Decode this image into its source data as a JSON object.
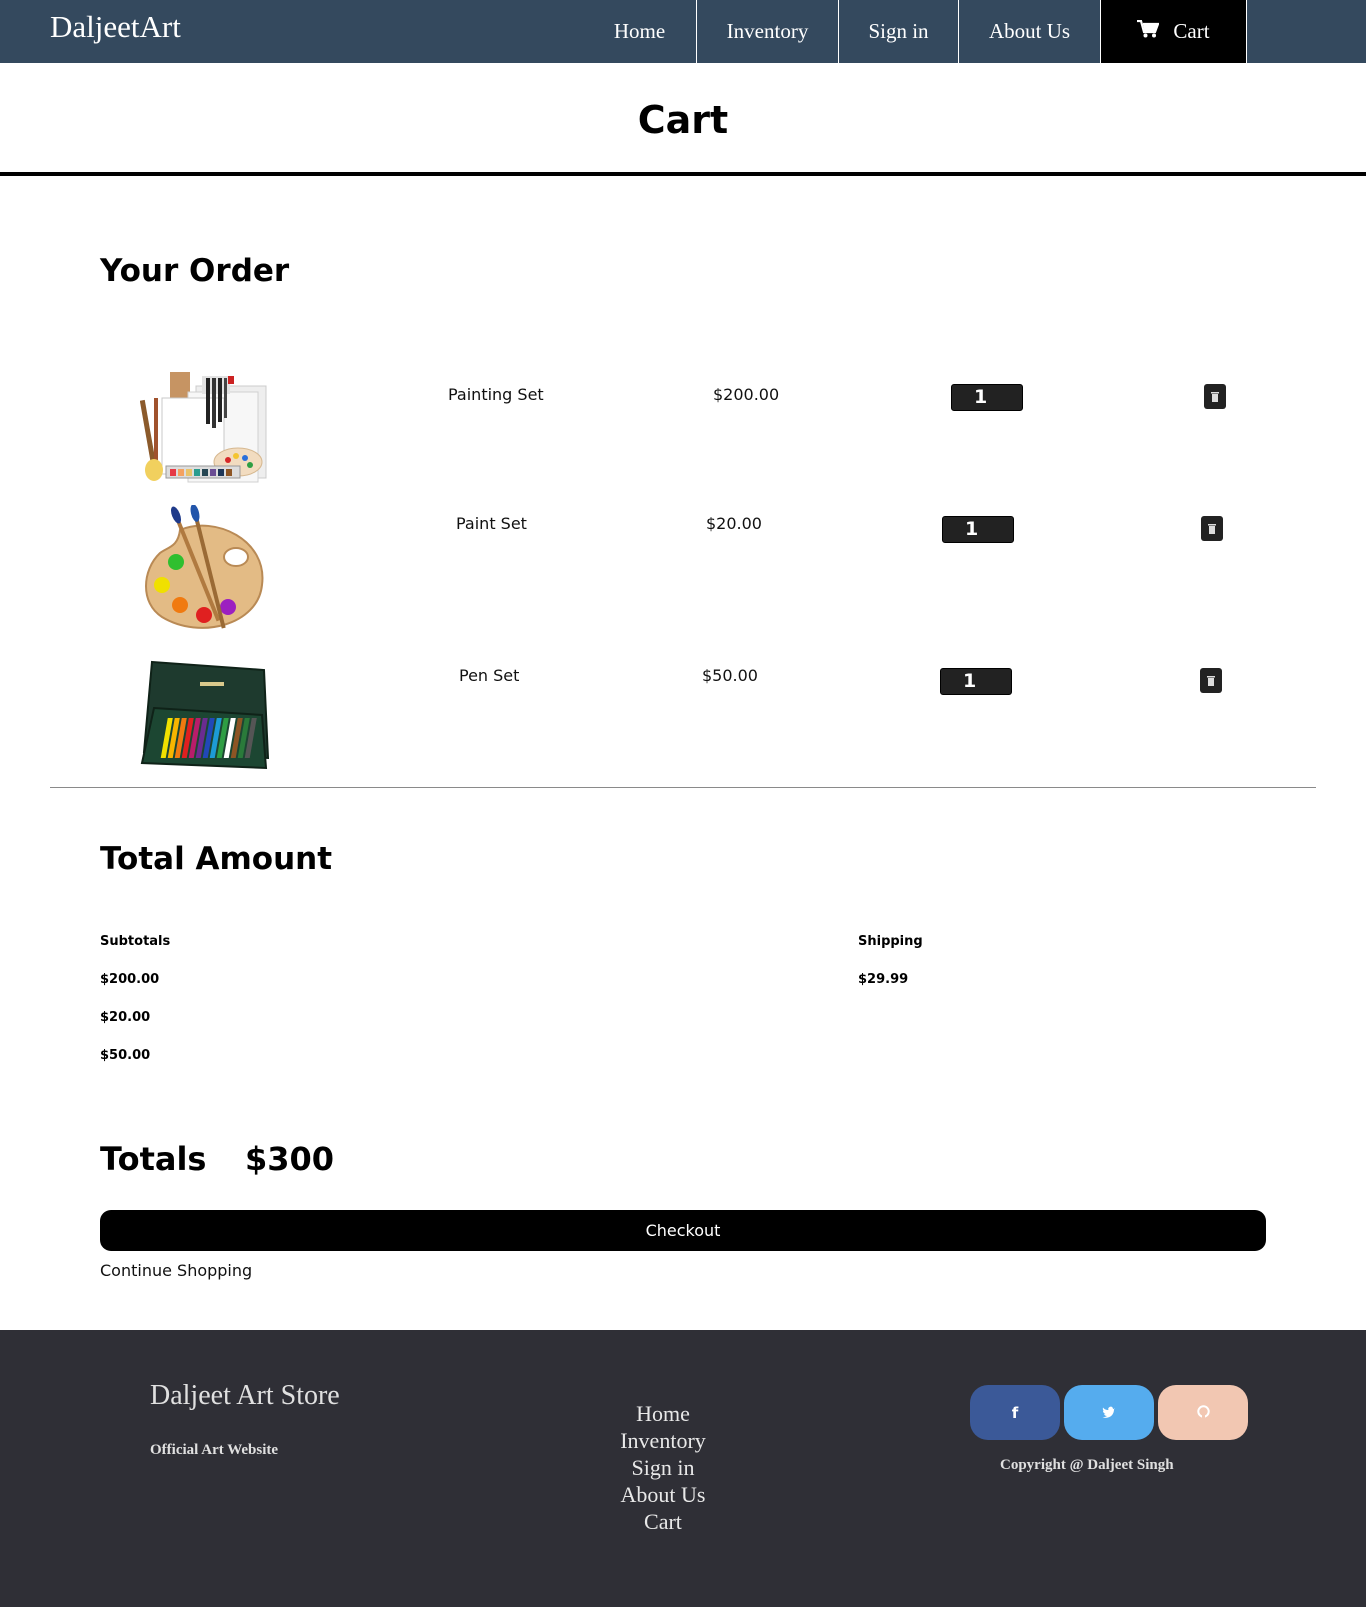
{
  "nav": {
    "brand": "DaljeetArt",
    "links": [
      "Home",
      "Inventory",
      "Sign in",
      "About Us",
      "Cart"
    ],
    "active": "Cart"
  },
  "page": {
    "title": "Cart",
    "order_heading": "Your Order",
    "items": [
      {
        "name": "Painting Set",
        "price": "$200.00",
        "qty": "1"
      },
      {
        "name": "Paint Set",
        "price": "$20.00",
        "qty": "1"
      },
      {
        "name": "Pen Set",
        "price": "$50.00",
        "qty": "1"
      }
    ],
    "total_heading": "Total Amount",
    "subtotals_label": "Subtotals",
    "subtotals": [
      "$200.00",
      "$20.00",
      "$50.00"
    ],
    "shipping_label": "Shipping",
    "shipping_value": "$29.99",
    "totals_label": "Totals",
    "totals_value": "$300",
    "checkout_label": "Checkout",
    "continue_label": "Continue Shopping"
  },
  "footer": {
    "brand": "Daljeet Art Store",
    "tagline": "Official Art Website",
    "links": [
      "Home",
      "Inventory",
      "Sign in",
      "About Us",
      "Cart"
    ],
    "social": [
      {
        "icon": "facebook-icon",
        "glyph": "f",
        "color": "#3b5998"
      },
      {
        "icon": "twitter-icon",
        "glyph": "",
        "color": "#55acee"
      },
      {
        "icon": "github-icon",
        "glyph": "",
        "color": "#f2c7b2"
      }
    ],
    "copyright": "Copyright @ Daljeet Singh"
  },
  "colors": {
    "navbar": "#34495e",
    "footer": "#2f2f36",
    "control": "#222222"
  }
}
